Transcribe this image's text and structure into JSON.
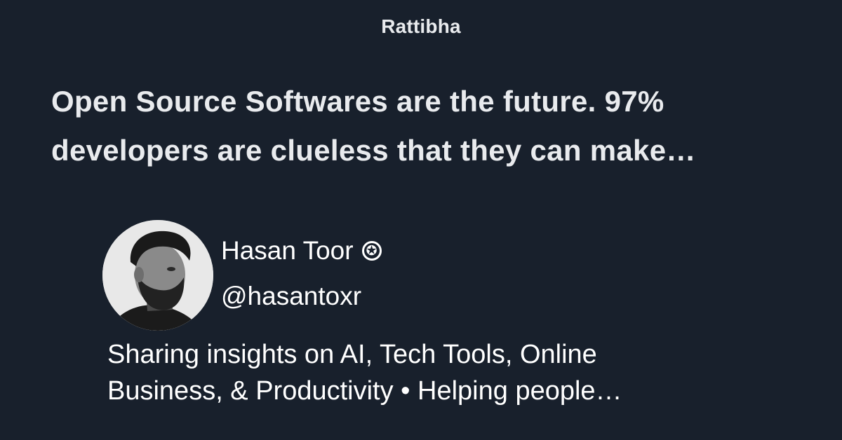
{
  "site": {
    "name": "Rattibha"
  },
  "thread": {
    "title_lines": [
      "Open Source Softwares are the future. 97%",
      "developers are clueless that they can make…"
    ]
  },
  "author": {
    "name": "Hasan Toor",
    "verified_icon": "✪",
    "handle": "@hasantoxr",
    "bio_lines": [
      "Sharing insights on AI, Tech Tools, Online",
      "Business, & Productivity • Helping people…"
    ]
  },
  "colors": {
    "background": "#18202c",
    "text": "#ffffff"
  }
}
